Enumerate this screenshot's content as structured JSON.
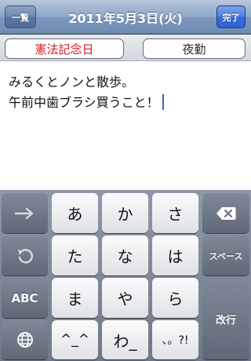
{
  "navbar": {
    "back_label": "一覧",
    "title": "2011年5月3日(火)",
    "done_label": "完了"
  },
  "segments": {
    "holiday": "憲法記念日",
    "shift": "夜勤"
  },
  "notes": {
    "lines": [
      "みるくとノンと散歩。",
      "午前中歯ブラシ買うこと！"
    ]
  },
  "keyboard": {
    "rows": [
      [
        "あ",
        "か",
        "さ"
      ],
      [
        "た",
        "な",
        "は"
      ],
      [
        "ま",
        "や",
        "ら"
      ],
      [
        "^_^",
        "わ_",
        "、。?!"
      ]
    ],
    "space_label": "スペース",
    "abc_label": "ABC",
    "return_label": "改行",
    "left_icons": [
      "arrow-right-icon",
      "undo-icon",
      "abc-key",
      "globe-icon"
    ],
    "right_icons": [
      "backspace-icon"
    ]
  },
  "colors": {
    "holiday_text": "#d71920",
    "caret": "#3a5fcf",
    "nav_done": "#2f62d3"
  }
}
